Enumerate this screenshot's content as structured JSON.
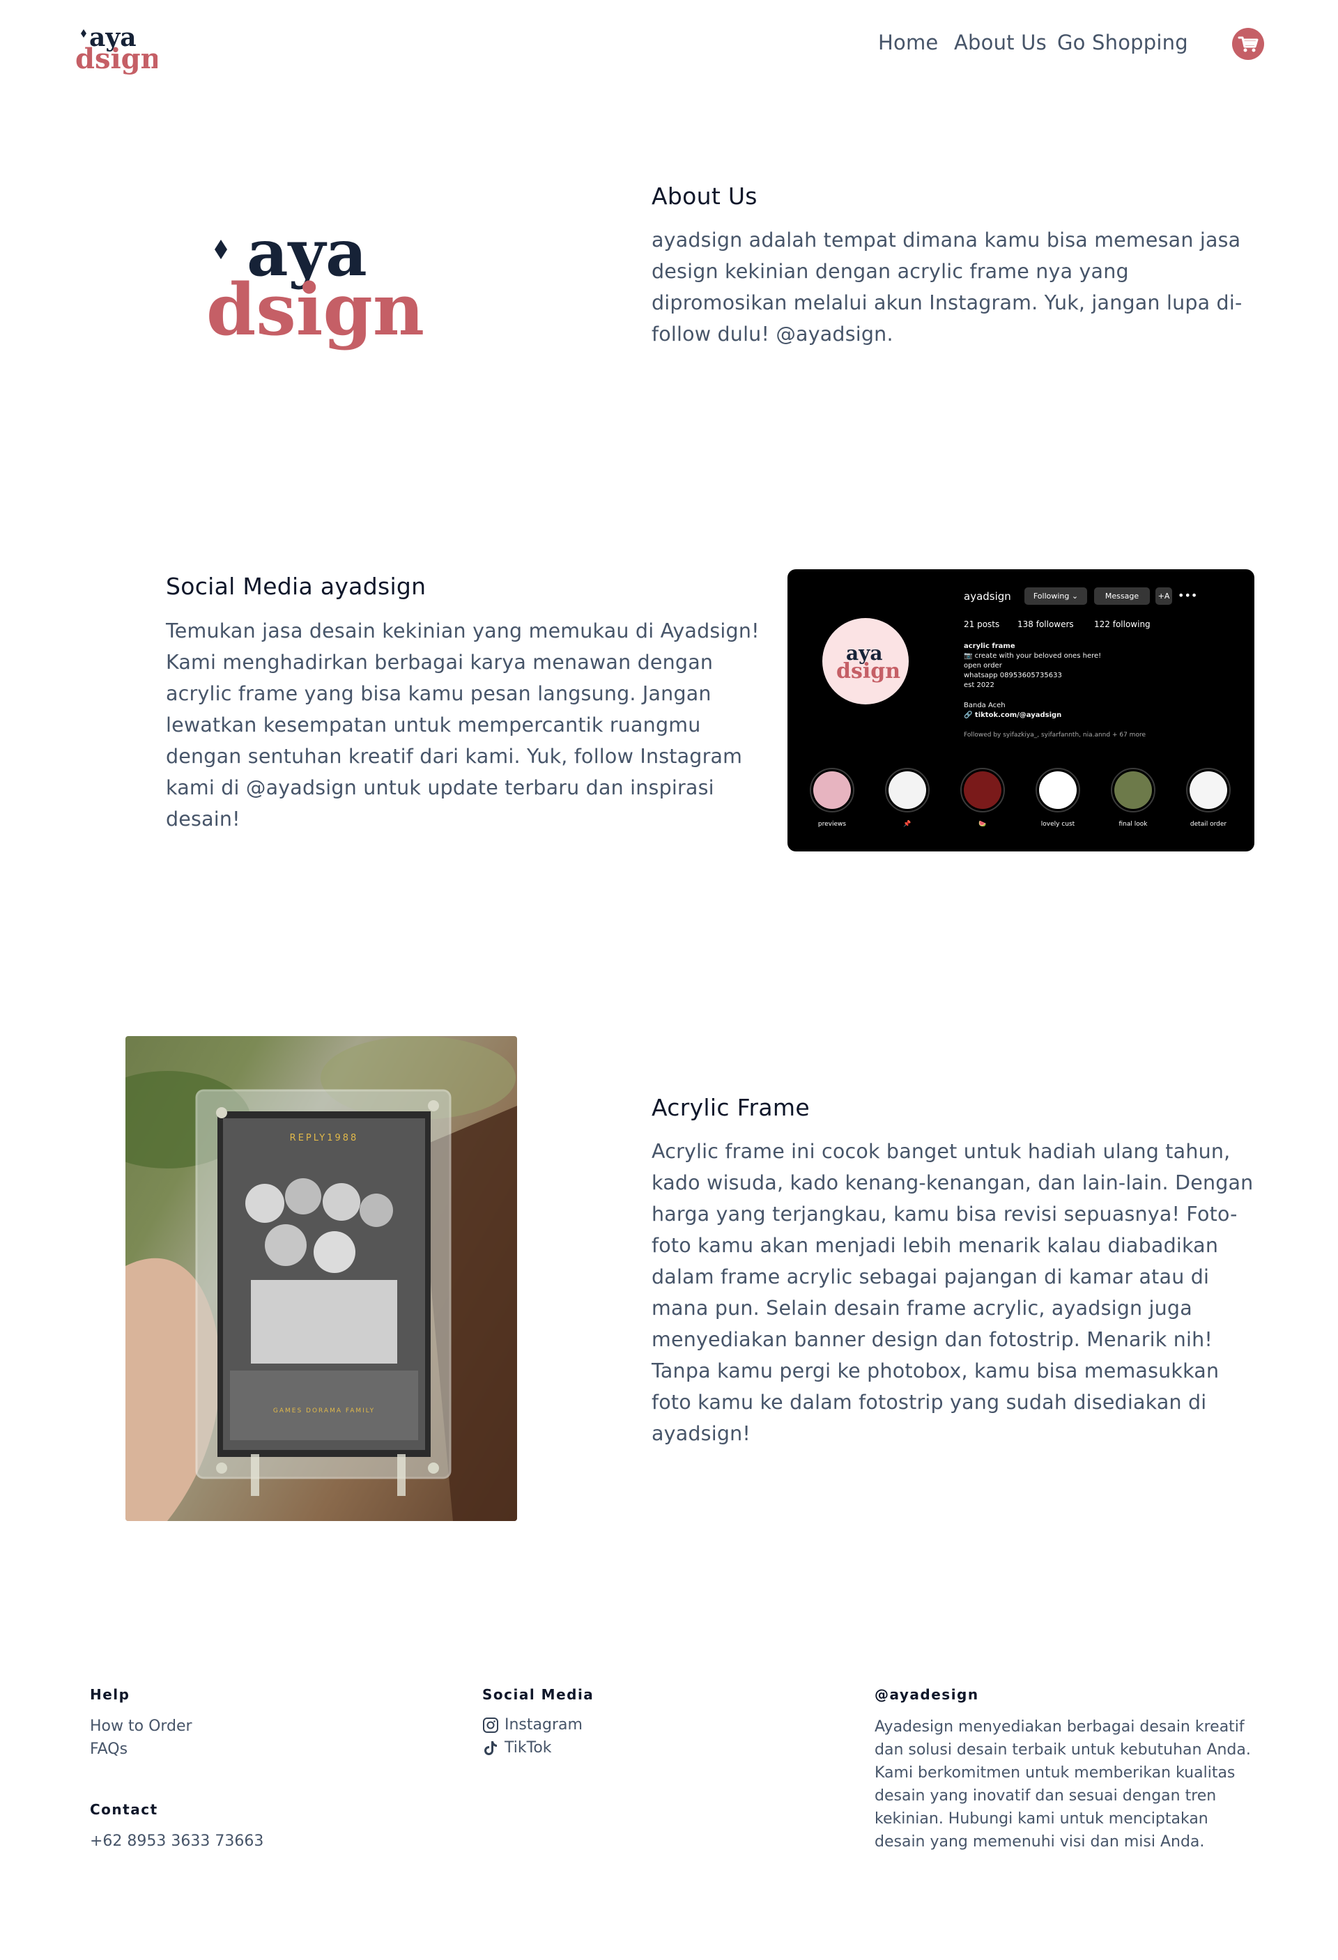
{
  "brand": {
    "logo_top": "aya",
    "logo_bottom": "dsign",
    "color_primary": "#c55f66",
    "color_dark": "#162237"
  },
  "nav": {
    "items": [
      {
        "label": "Home"
      },
      {
        "label": "About Us"
      },
      {
        "label": "Go Shopping"
      }
    ],
    "cart_icon": "shopping-cart-icon"
  },
  "about": {
    "title": "About Us",
    "text": "ayadsign adalah tempat dimana kamu bisa memesan jasa design kekinian dengan acrylic frame nya yang dipromosikan melalui akun Instagram. Yuk, jangan lupa di-follow dulu! @ayadsign."
  },
  "social": {
    "title": "Social Media ayadsign",
    "text": "Temukan jasa desain kekinian yang memukau di Ayadsign! Kami menghadirkan berbagai karya menawan dengan acrylic frame yang bisa kamu pesan langsung. Jangan lewatkan kesempatan untuk mempercantik ruangmu dengan sentuhan kreatif dari kami. Yuk, follow Instagram kami di @ayadsign untuk update terbaru dan inspirasi desain!",
    "instagram": {
      "username": "ayadsign",
      "following_btn": "Following ⌄",
      "message_btn": "Message",
      "add_btn": "+A",
      "posts": "21 posts",
      "followers": "138 followers",
      "following": "122 following",
      "bio_name": "acrylic frame",
      "bio_lines": [
        "📷 create with your beloved ones here!",
        "open order",
        "whatsapp 08953605735633",
        "est 2022"
      ],
      "location": "Banda Aceh",
      "link": "🔗 tiktok.com/@ayadsign",
      "followed_by": "Followed by syifazkiya_, syifarfannth, nia.annd + 67 more",
      "highlights": [
        {
          "label": "previews",
          "color": "#e7b4c0"
        },
        {
          "label": "📌",
          "color": "#f3f3f3"
        },
        {
          "label": "🍉",
          "color": "#7a1a1a"
        },
        {
          "label": "lovely cust",
          "color": "#ffffff"
        },
        {
          "label": "final look",
          "color": "#6d7a4a"
        },
        {
          "label": "detail order",
          "color": "#f5f5f5"
        }
      ]
    }
  },
  "acrylic": {
    "title": "Acrylic Frame",
    "text": "Acrylic frame ini cocok banget untuk hadiah ulang tahun, kado wisuda, kado kenang-kenangan, dan lain-lain. Dengan harga yang terjangkau, kamu bisa revisi sepuasnya! Foto-foto kamu akan menjadi lebih menarik kalau diabadikan dalam frame acrylic sebagai pajangan di kamar atau di mana pun. Selain desain frame acrylic, ayadsign juga menyediakan banner design dan fotostrip. Menarik nih! Tanpa kamu pergi ke photobox, kamu bisa memasukkan foto kamu ke dalam fotostrip yang sudah disediakan di ayadsign!",
    "photo_top_text": "REPLY1988",
    "photo_bottom_text": "GAMES DORAMA FAMILY"
  },
  "footer": {
    "help": {
      "title": "Help",
      "links": [
        "How to Order",
        "FAQs"
      ]
    },
    "contact": {
      "title": "Contact",
      "phone": "+62 8953 3633 73663"
    },
    "social": {
      "title": "Social Media",
      "links": [
        {
          "label": "Instagram",
          "icon": "instagram-icon"
        },
        {
          "label": "TikTok",
          "icon": "tiktok-icon"
        }
      ]
    },
    "about": {
      "title": "@ayadesign",
      "text": "Ayadesign menyediakan berbagai desain kreatif dan solusi desain terbaik untuk kebutuhan Anda. Kami berkomitmen untuk memberikan kualitas desain yang inovatif dan sesuai dengan tren kekinian. Hubungi kami untuk menciptakan desain yang memenuhi visi dan misi Anda."
    }
  }
}
